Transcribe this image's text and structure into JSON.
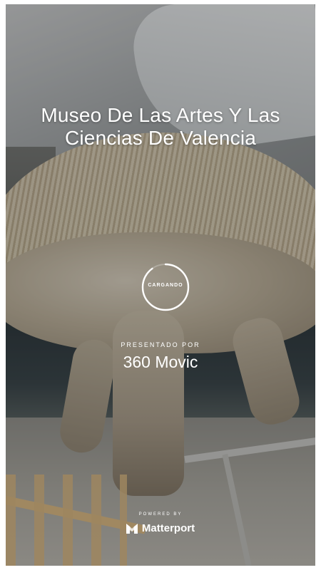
{
  "tour": {
    "title": "Museo De Las Artes Y Las Ciencias De Valencia"
  },
  "loading": {
    "label": "CARGANDO",
    "progress": 0.9
  },
  "credits": {
    "presented_by": "PRESENTADO POR",
    "presenter": "360 Movic"
  },
  "branding": {
    "powered_by": "POWERED BY",
    "name": "Matterport",
    "logo_icon": "matterport-logo-icon"
  },
  "colors": {
    "text": "#ffffff",
    "spinner": "#ffffff"
  }
}
